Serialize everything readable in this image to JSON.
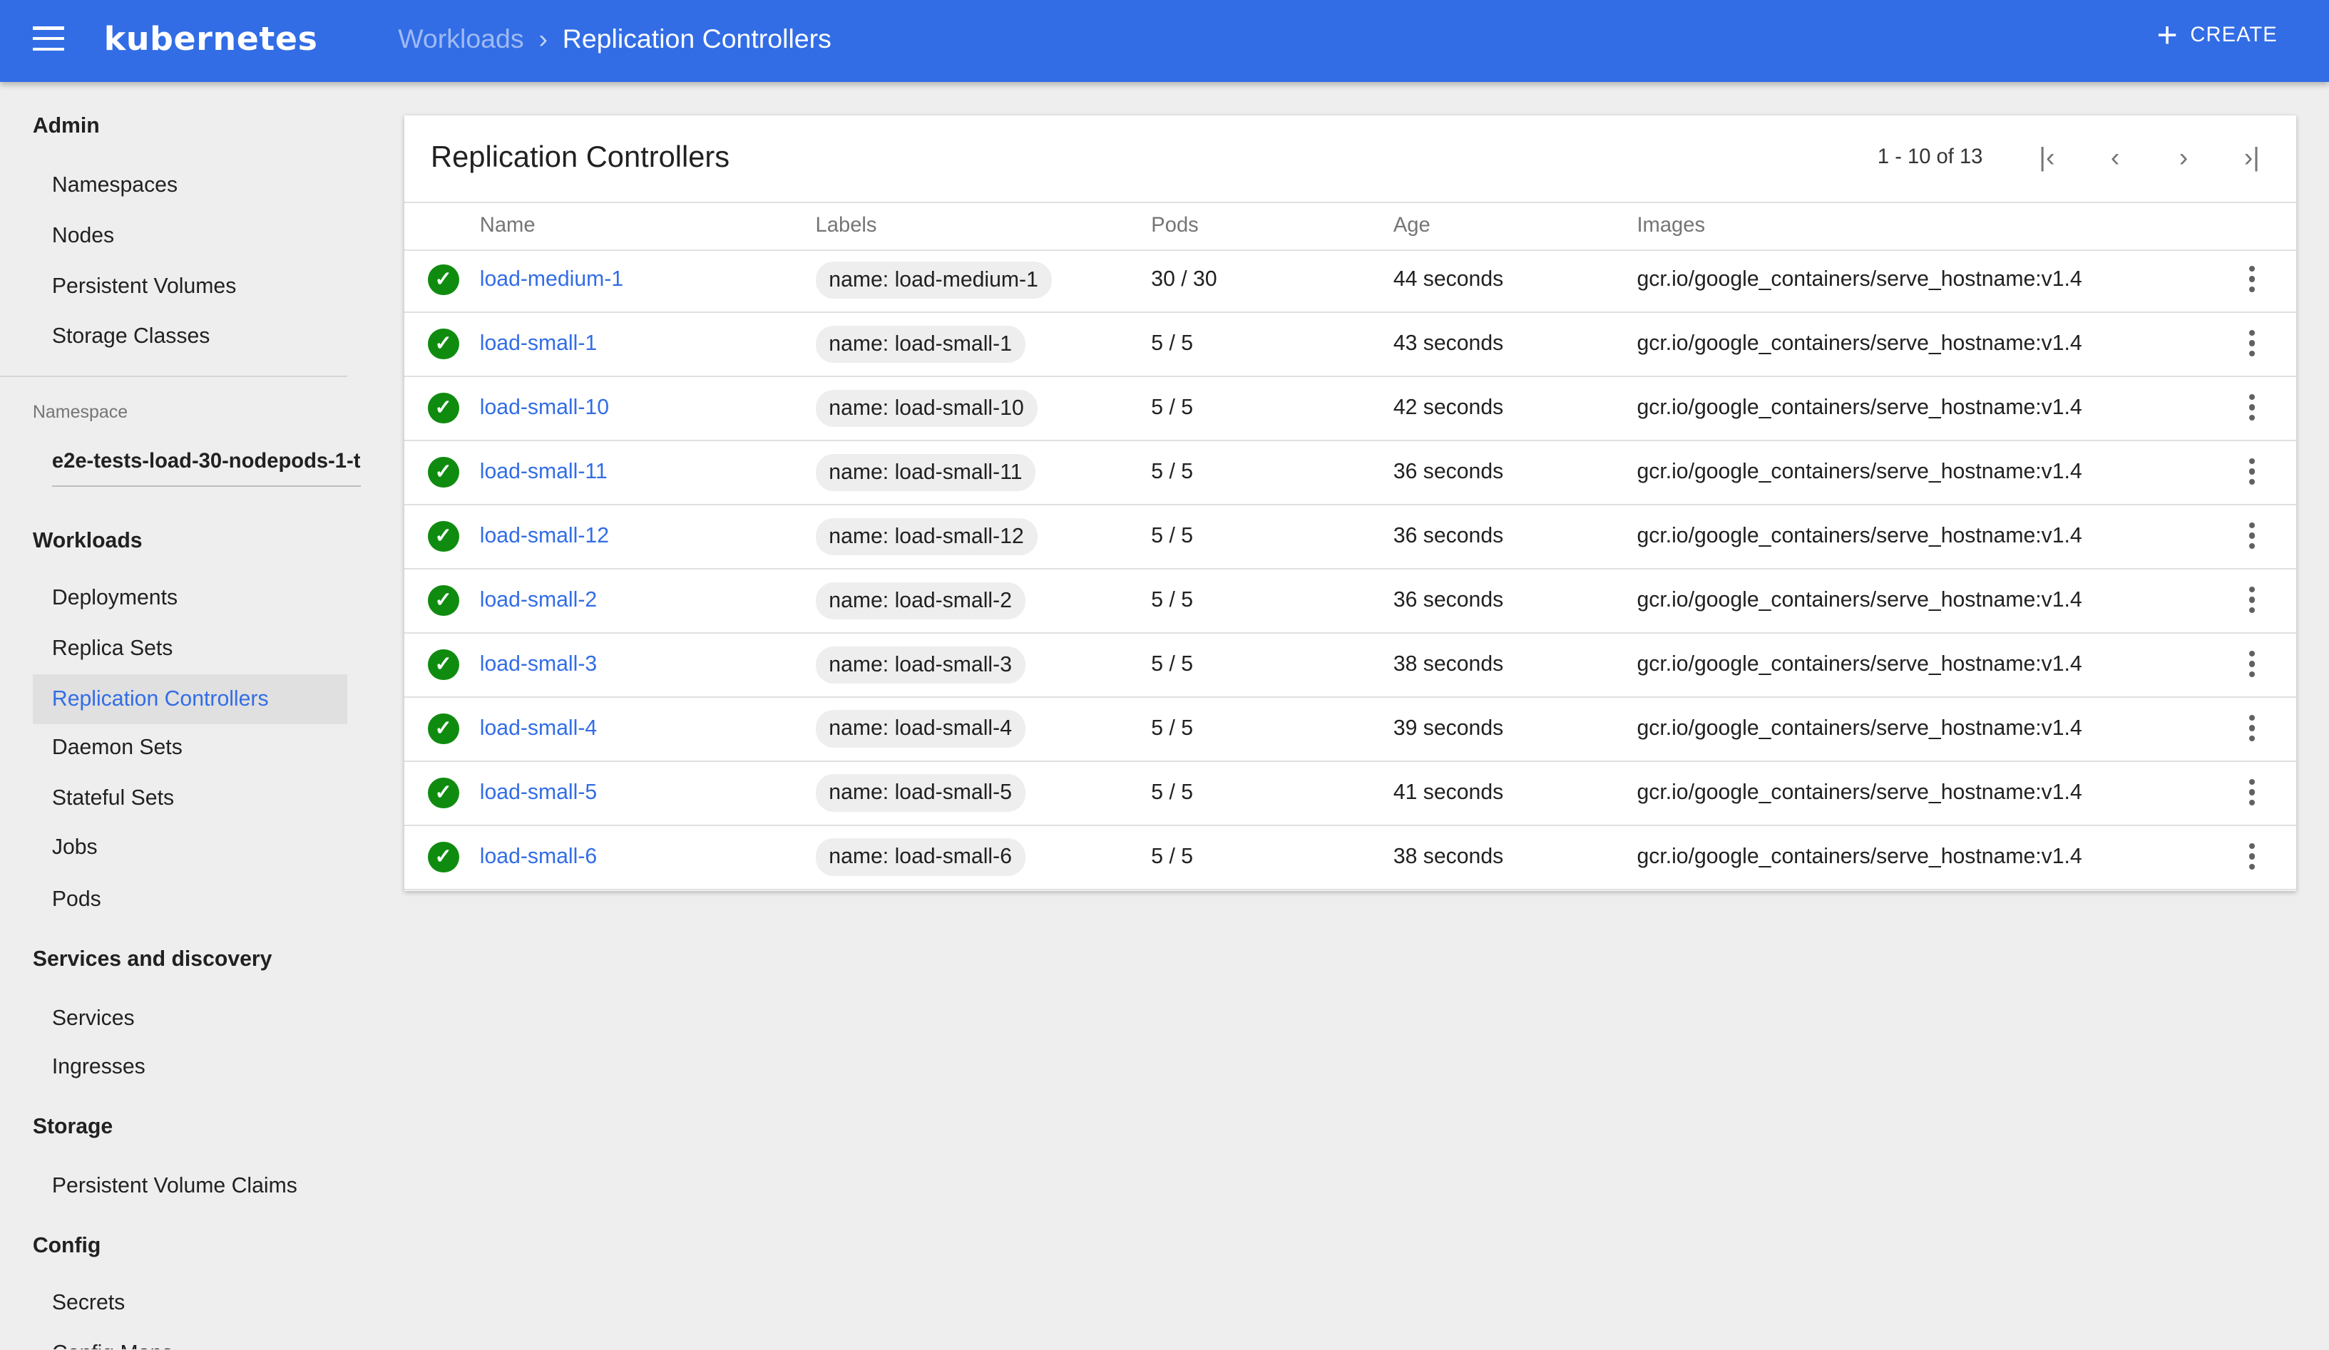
{
  "header": {
    "logo": "kubernetes",
    "breadcrumb": [
      "Workloads",
      "Replication Controllers"
    ],
    "create_label": "CREATE",
    "accent": "#326de6"
  },
  "sidebar": {
    "admin": "Admin",
    "admin_items": [
      "Namespaces",
      "Nodes",
      "Persistent Volumes",
      "Storage Classes"
    ],
    "namespace_label": "Namespace",
    "namespace_value": "e2e-tests-load-30-nodepods-1-t",
    "workloads": "Workloads",
    "workload_items": [
      "Deployments",
      "Replica Sets",
      "Replication Controllers",
      "Daemon Sets",
      "Stateful Sets",
      "Jobs",
      "Pods"
    ],
    "services": "Services and discovery",
    "service_items": [
      "Services",
      "Ingresses"
    ],
    "storage": "Storage",
    "storage_items": [
      "Persistent Volume Claims"
    ],
    "config": "Config",
    "config_items": [
      "Secrets",
      "Config Maps"
    ]
  },
  "card": {
    "title": "Replication Controllers",
    "pagination": "1 - 10 of 13",
    "columns": [
      "Name",
      "Labels",
      "Pods",
      "Age",
      "Images"
    ],
    "rows": [
      {
        "name": "load-medium-1",
        "label": "name: load-medium-1",
        "pods": "30 / 30",
        "age": "44 seconds",
        "image": "gcr.io/google_containers/serve_hostname:v1.4"
      },
      {
        "name": "load-small-1",
        "label": "name: load-small-1",
        "pods": "5 / 5",
        "age": "43 seconds",
        "image": "gcr.io/google_containers/serve_hostname:v1.4"
      },
      {
        "name": "load-small-10",
        "label": "name: load-small-10",
        "pods": "5 / 5",
        "age": "42 seconds",
        "image": "gcr.io/google_containers/serve_hostname:v1.4"
      },
      {
        "name": "load-small-11",
        "label": "name: load-small-11",
        "pods": "5 / 5",
        "age": "36 seconds",
        "image": "gcr.io/google_containers/serve_hostname:v1.4"
      },
      {
        "name": "load-small-12",
        "label": "name: load-small-12",
        "pods": "5 / 5",
        "age": "36 seconds",
        "image": "gcr.io/google_containers/serve_hostname:v1.4"
      },
      {
        "name": "load-small-2",
        "label": "name: load-small-2",
        "pods": "5 / 5",
        "age": "36 seconds",
        "image": "gcr.io/google_containers/serve_hostname:v1.4"
      },
      {
        "name": "load-small-3",
        "label": "name: load-small-3",
        "pods": "5 / 5",
        "age": "38 seconds",
        "image": "gcr.io/google_containers/serve_hostname:v1.4"
      },
      {
        "name": "load-small-4",
        "label": "name: load-small-4",
        "pods": "5 / 5",
        "age": "39 seconds",
        "image": "gcr.io/google_containers/serve_hostname:v1.4"
      },
      {
        "name": "load-small-5",
        "label": "name: load-small-5",
        "pods": "5 / 5",
        "age": "41 seconds",
        "image": "gcr.io/google_containers/serve_hostname:v1.4"
      },
      {
        "name": "load-small-6",
        "label": "name: load-small-6",
        "pods": "5 / 5",
        "age": "38 seconds",
        "image": "gcr.io/google_containers/serve_hostname:v1.4"
      }
    ]
  }
}
